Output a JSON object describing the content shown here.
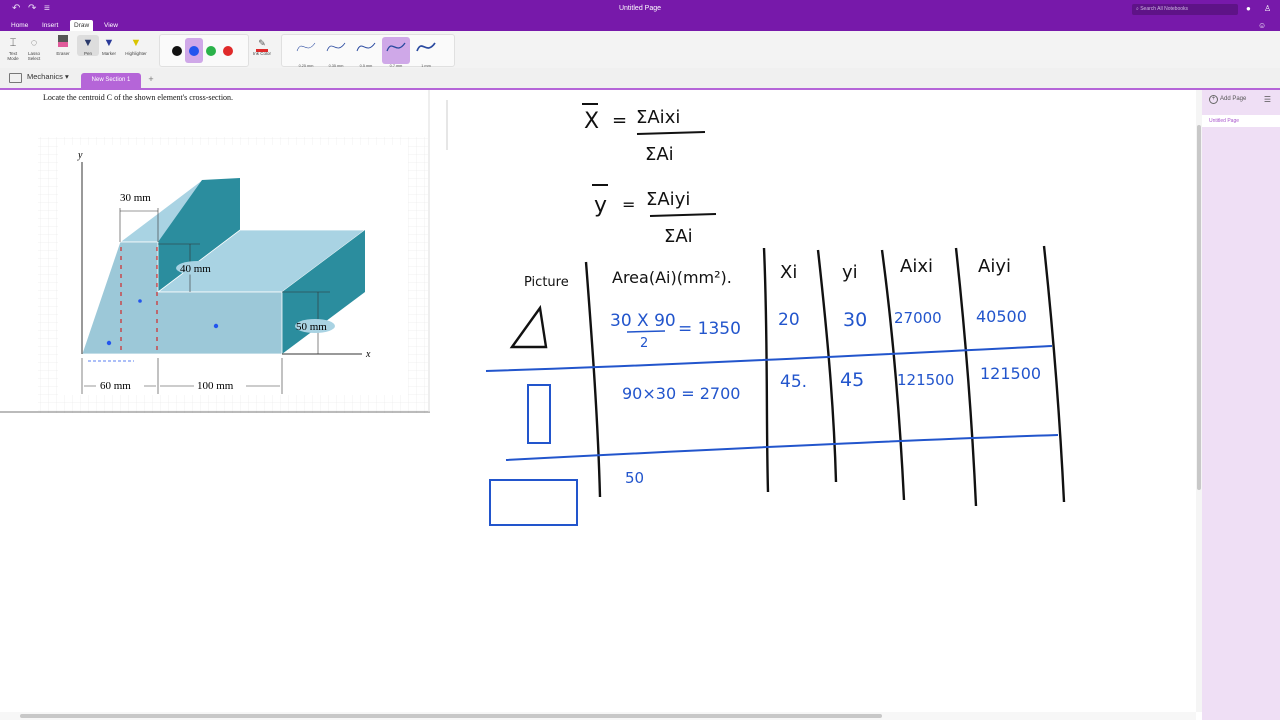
{
  "titlebar": {
    "title": "Untitled Page",
    "search_placeholder": "Search All Notebooks",
    "quick_access": {
      "undo": "↶",
      "redo": "↷",
      "customize": "≡"
    }
  },
  "menu": {
    "tabs": [
      "Home",
      "Insert",
      "Draw",
      "View"
    ],
    "active": "Draw"
  },
  "ribbon": {
    "tools": [
      {
        "label1": "Text",
        "label2": "Mode"
      },
      {
        "label1": "Lasso",
        "label2": "Select"
      },
      {
        "label1": "Eraser",
        "label2": ""
      },
      {
        "label1": "Pen",
        "label2": ""
      },
      {
        "label1": "Marker",
        "label2": ""
      },
      {
        "label1": "Highlighter",
        "label2": ""
      }
    ],
    "ink_color_label": "Ink Color",
    "colors": [
      "#111111",
      "#2255ee",
      "#2ab24a",
      "#e02a2a"
    ],
    "widths": [
      "0.25 mm",
      "0.35 mm",
      "0.5 mm",
      "0.7 mm",
      "1 mm"
    ],
    "active_width": "0.7 mm"
  },
  "notebook": {
    "name": "Mechanics",
    "section": "New Section 1",
    "add_section": "+"
  },
  "page": {
    "problem_text": "Locate the centroid C of the shown element's cross-section."
  },
  "figure": {
    "axis_y": "y",
    "axis_x": "x",
    "dim_30": "30 mm",
    "dim_40": "40 mm",
    "dim_50": "50 mm",
    "dim_60": "60 mm",
    "dim_100": "100 mm"
  },
  "handwriting": {
    "xbar_lhs": "X",
    "xbar_num": "ΣAixi",
    "xbar_den": "ΣAi",
    "ybar_lhs": "y",
    "ybar_num": "ΣAiyi",
    "ybar_den": "ΣAi",
    "headers": [
      "Picture",
      "Area(Ai)(mm²).",
      "Xi",
      "yi",
      "Aixi",
      "Aiyi"
    ],
    "row1": {
      "area_num": "30 X 90",
      "area_den": "2",
      "area_res": "= 1350",
      "xi": "20",
      "yi": "30",
      "aixi": "27000",
      "aiyi": "40500"
    },
    "row2": {
      "area": "90×30 = 2700",
      "xi": "45.",
      "yi": "45",
      "aixi": "121500",
      "aiyi": "121500"
    },
    "row3": {
      "area": "50"
    }
  },
  "pages_pane": {
    "add_page": "Add Page",
    "pages": [
      "Untitled Page"
    ]
  },
  "colors": {
    "brand": "#7719aa",
    "section": "#b565d8",
    "pane": "#efdff5",
    "ink_blue": "#2255cc",
    "ink_black": "#111111"
  }
}
